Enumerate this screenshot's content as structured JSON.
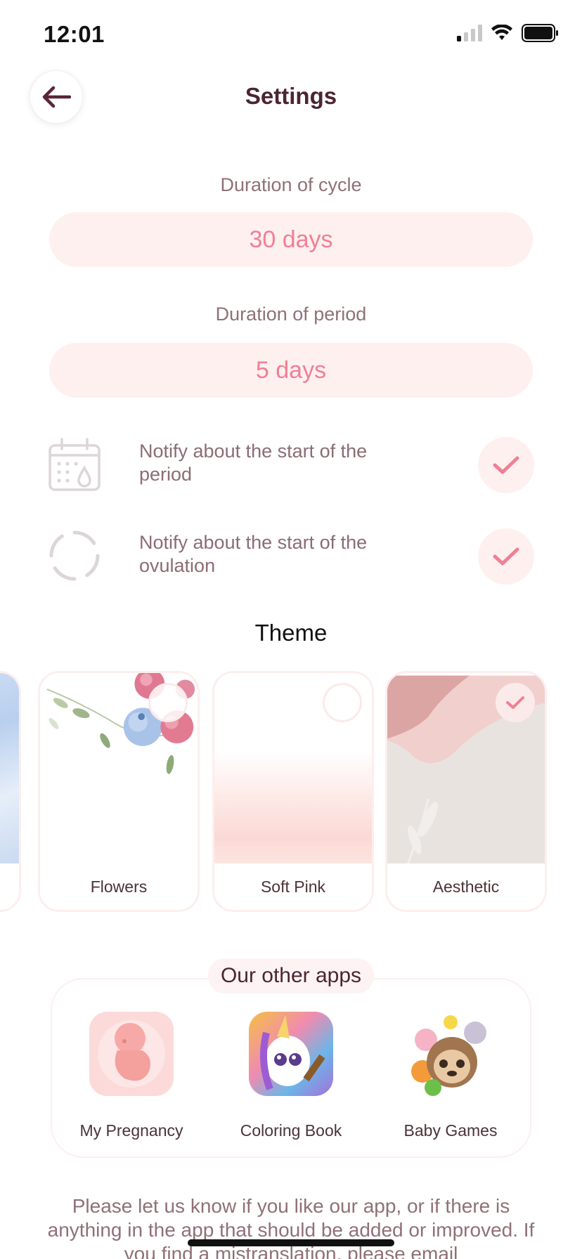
{
  "status_bar": {
    "time": "12:01"
  },
  "header": {
    "title": "Settings"
  },
  "cycle": {
    "label": "Duration of cycle",
    "value": "30 days"
  },
  "period": {
    "label": "Duration of period",
    "value": "5 days"
  },
  "notifications": [
    {
      "label": "Notify about the start of the period",
      "icon": "calendar-icon",
      "checked": true
    },
    {
      "label": "Notify about the start of the ovulation",
      "icon": "dashed-circle-icon",
      "checked": true
    }
  ],
  "theme": {
    "title": "Theme",
    "items": [
      {
        "name": "Flowers",
        "selected": false
      },
      {
        "name": "Soft Pink",
        "selected": false
      },
      {
        "name": "Aesthetic",
        "selected": true
      }
    ]
  },
  "other_apps": {
    "title": "Our other apps",
    "items": [
      {
        "name": "My Pregnancy"
      },
      {
        "name": "Coloring Book"
      },
      {
        "name": "Baby Games"
      }
    ]
  },
  "feedback_text": "Please let us know if you like our app, or if there is anything in the app that should be added or improved. If you find a mistranslation, please email",
  "colors": {
    "accent": "#f07f95",
    "pill_bg": "#fff0f0",
    "title": "#4b2531"
  }
}
